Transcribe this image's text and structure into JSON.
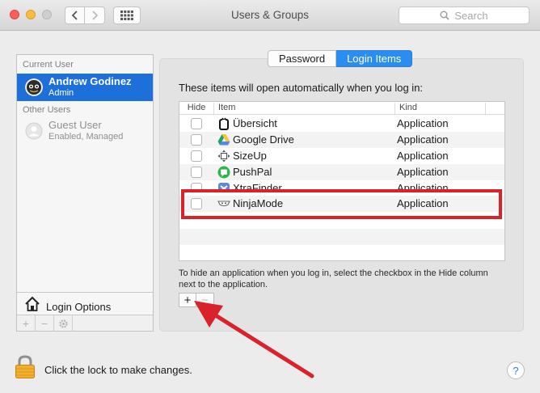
{
  "window": {
    "title": "Users & Groups",
    "search_placeholder": "Search"
  },
  "sidebar": {
    "current_user_label": "Current User",
    "current_user": {
      "name": "Andrew Godinez",
      "role": "Admin"
    },
    "other_users_label": "Other Users",
    "other_users": [
      {
        "name": "Guest User",
        "status": "Enabled, Managed"
      }
    ],
    "login_options_label": "Login Options",
    "buttons": [
      "+",
      "−",
      "gear-icon"
    ]
  },
  "tabs": [
    {
      "label": "Password",
      "active": false
    },
    {
      "label": "Login Items",
      "active": true
    }
  ],
  "login_items": {
    "intro": "These items will open automatically when you log in:",
    "columns": {
      "hide": "Hide",
      "item": "Item",
      "kind": "Kind"
    },
    "rows": [
      {
        "name": "Übersicht",
        "kind": "Application",
        "hide": false,
        "icon": "ubersicht-icon"
      },
      {
        "name": "Google Drive",
        "kind": "Application",
        "hide": false,
        "icon": "google-drive-icon"
      },
      {
        "name": "SizeUp",
        "kind": "Application",
        "hide": false,
        "icon": "sizeup-icon"
      },
      {
        "name": "PushPal",
        "kind": "Application",
        "hide": false,
        "icon": "pushpal-icon"
      },
      {
        "name": "XtraFinder",
        "kind": "Application",
        "hide": false,
        "icon": "xtrafinder-icon"
      },
      {
        "name": "NinjaMode",
        "kind": "Application",
        "hide": false,
        "icon": "ninjamode-icon"
      }
    ],
    "hint": "To hide an application when you log in, select the checkbox in the Hide column next to the application.",
    "add_label": "+",
    "remove_label": "−"
  },
  "footer": {
    "lock_text": "Click the lock to make changes.",
    "help_label": "?"
  },
  "colors": {
    "accent": "#1d6fd9",
    "annotation": "#d9222a"
  }
}
